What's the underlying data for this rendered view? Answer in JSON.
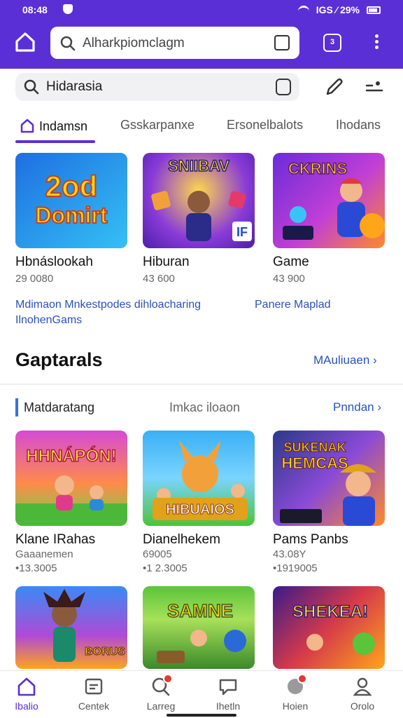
{
  "status": {
    "time": "08:48",
    "indicators": "IGS ⁄ 29%"
  },
  "browser": {
    "url_text": "Alharkpiomclagm",
    "tab_count": "3"
  },
  "search": {
    "value": "Hidarasia"
  },
  "category_tabs": [
    {
      "label": "Indamsn"
    },
    {
      "label": "Gsskarpanxe"
    },
    {
      "label": "Ersonelbalots"
    },
    {
      "label": "Ihodans"
    }
  ],
  "top_cards": [
    {
      "title": "Hbnáslookah",
      "meta": "29 0080",
      "art_text": "2od Domirt"
    },
    {
      "title": "Hiburan",
      "meta": "43 600",
      "art_text": "SNIIBAV"
    },
    {
      "title": "Game",
      "meta": "43 900",
      "art_text": "CKRINS"
    }
  ],
  "promo_links": {
    "left_line1": "Mdimaon Mnkestpodes dihloacharing",
    "left_line2": "IlnohenGams",
    "right": "Panere Maplad"
  },
  "section": {
    "title": "Gaptarals",
    "more_link": "MAuliuaen ›",
    "sub_label": "Matdaratang",
    "sub_mid": "Imkac iloaon",
    "sub_link": "Pnndan ›"
  },
  "grid_cards": [
    {
      "title": "Klane IRahas",
      "line1": "Gaaanemen",
      "line2": "•13.3005",
      "art_text": "HHNÁPÓN!"
    },
    {
      "title": "Dianelhekem",
      "line1": "69005",
      "line2": "•1 2.3005",
      "art_text": "HIBUAIOS"
    },
    {
      "title": "Pams Panbs",
      "line1": "43.08Y",
      "line2": "•1919005",
      "art_text": "SUKENAK HEMCAS"
    },
    {
      "title": "",
      "line1": "",
      "line2": "",
      "art_text": "BORUS"
    },
    {
      "title": "",
      "line1": "",
      "line2": "",
      "art_text": "SAMNE"
    },
    {
      "title": "",
      "line1": "",
      "line2": "",
      "art_text": "SHEKEA!"
    }
  ],
  "bottom_nav": [
    {
      "label": "Ibalio",
      "icon": "home-icon"
    },
    {
      "label": "Centek",
      "icon": "store-icon"
    },
    {
      "label": "Larreg",
      "icon": "search-icon"
    },
    {
      "label": "Ihetln",
      "icon": "chat-icon"
    },
    {
      "label": "Hoien",
      "icon": "bell-icon"
    },
    {
      "label": "Orolo",
      "icon": "profile-icon"
    }
  ],
  "colors": {
    "brand": "#5b2fd6",
    "link": "#2a52be",
    "notification": "#e53935"
  }
}
